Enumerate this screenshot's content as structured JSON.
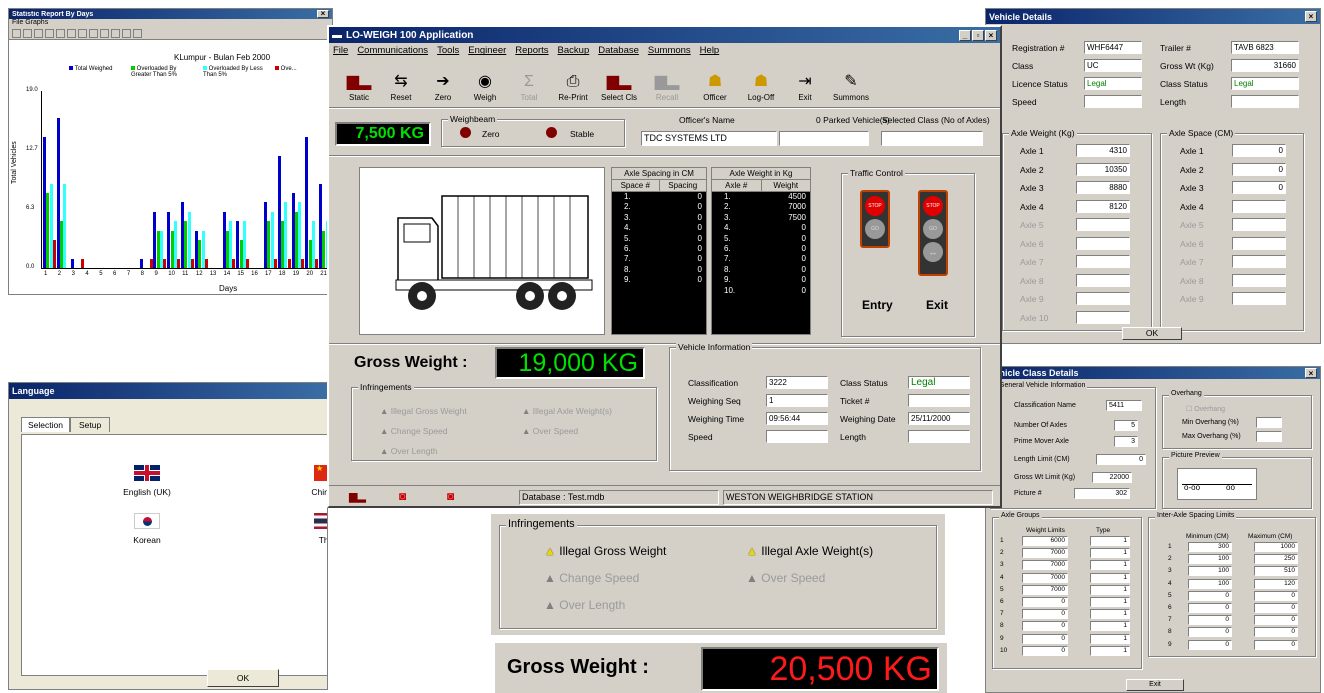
{
  "stat": {
    "title": "Statistic Report By Days",
    "menu": [
      "File",
      "Graphs"
    ],
    "chart_title": "KLumpur - Bulan Feb 2000",
    "legend": [
      "Total Weighed",
      "Overloaded By Greater Than 5%",
      "Overloaded By Less Than 5%",
      "Ove..."
    ],
    "ylabel": "Total Vehicles",
    "xlabel": "Days",
    "yticks": [
      "19.0",
      "12.7",
      "6.3",
      "0.0"
    ]
  },
  "chart_data": {
    "type": "bar",
    "categories": [
      "1",
      "2",
      "3",
      "4",
      "5",
      "6",
      "7",
      "8",
      "9",
      "10",
      "11",
      "12",
      "13",
      "14",
      "15",
      "16",
      "17",
      "18",
      "19",
      "20",
      "21"
    ],
    "series": [
      {
        "name": "Total Weighed",
        "color": "#0000cc",
        "values": [
          14,
          16,
          1,
          0,
          0,
          0,
          0,
          1,
          6,
          6,
          7,
          4,
          0,
          6,
          5,
          0,
          7,
          12,
          8,
          14,
          9
        ]
      },
      {
        "name": "Overloaded By Greater Than 5%",
        "color": "#00cc00",
        "values": [
          8,
          5,
          0,
          0,
          0,
          0,
          0,
          0,
          4,
          4,
          5,
          3,
          0,
          4,
          3,
          0,
          5,
          5,
          6,
          3,
          4
        ]
      },
      {
        "name": "Overloaded By Less Than 5%",
        "color": "#33ffff",
        "values": [
          9,
          9,
          0,
          0,
          0,
          0,
          0,
          0,
          4,
          5,
          6,
          4,
          0,
          5,
          5,
          0,
          6,
          7,
          7,
          5,
          5
        ]
      },
      {
        "name": "Ove...",
        "color": "#cc0000",
        "values": [
          3,
          0,
          1,
          0,
          0,
          0,
          0,
          1,
          1,
          1,
          1,
          1,
          0,
          1,
          1,
          0,
          1,
          1,
          1,
          1,
          1
        ]
      }
    ],
    "ylim": [
      0,
      19
    ],
    "xlabel": "Days",
    "ylabel": "Total Vehicles",
    "title": "KLumpur - Bulan Feb 2000"
  },
  "lw": {
    "title": "LO-WEIGH 100 Application",
    "menu": [
      "File",
      "Communications",
      "Tools",
      "Engineer",
      "Reports",
      "Backup",
      "Database",
      "Summons",
      "Help"
    ],
    "tools": [
      "Static",
      "Reset",
      "Zero",
      "Weigh",
      "Total",
      "Re-Print",
      "Select Cls",
      "Recall",
      "Officer",
      "Log-Off",
      "Exit",
      "Summons"
    ],
    "weight": "7,500 KG",
    "weighbeam": "Weighbeam",
    "zero": "Zero",
    "stable": "Stable",
    "officer_label": "Officer's Name",
    "parked": "0  Parked Vehicle(s)",
    "selclass": "Selected Class (No of Axles)",
    "officer": "TDC SYSTEMS LTD",
    "sp_head": "Axle Spacing in CM",
    "sp_cols": [
      "Space #",
      "Spacing"
    ],
    "sp_rows": [
      [
        "1.",
        "0"
      ],
      [
        "2.",
        "0"
      ],
      [
        "3.",
        "0"
      ],
      [
        "4.",
        "0"
      ],
      [
        "5.",
        "0"
      ],
      [
        "6.",
        "0"
      ],
      [
        "7.",
        "0"
      ],
      [
        "8.",
        "0"
      ],
      [
        "9.",
        "0"
      ]
    ],
    "wt_head": "Axle Weight in Kg",
    "wt_cols": [
      "Axle #",
      "Weight"
    ],
    "wt_rows": [
      [
        "1.",
        "4500"
      ],
      [
        "2.",
        "7000"
      ],
      [
        "3.",
        "7500"
      ],
      [
        "4.",
        "0"
      ],
      [
        "5.",
        "0"
      ],
      [
        "6.",
        "0"
      ],
      [
        "7.",
        "0"
      ],
      [
        "8.",
        "0"
      ],
      [
        "9.",
        "0"
      ],
      [
        "10.",
        "0"
      ]
    ],
    "traffic": "Traffic Control",
    "stop": "STOP",
    "go": "GO",
    "entry": "Entry",
    "exit": "Exit",
    "gross_label": "Gross Weight :",
    "gross": "19,000 KG",
    "infr": "Infringements",
    "infr_items": [
      "Illegal Gross Weight",
      "Illegal Axle Weight(s)",
      "Change Speed",
      "Over Speed",
      "Over Length"
    ],
    "vinfo": "Vehicle Information",
    "classification": "Classification",
    "classification_v": "3222",
    "seq": "Weighing Seq",
    "seq_v": "1",
    "time": "Weighing Time",
    "time_v": "09:56:44",
    "speed": "Speed",
    "cstatus": "Class Status",
    "cstatus_v": "Legal",
    "ticket": "Ticket #",
    "wdate": "Weighing Date",
    "wdate_v": "25/11/2000",
    "length": "Length",
    "db": "Database : Test.mdb",
    "station": "WESTON WEIGHBRIDGE STATION"
  },
  "vd": {
    "title": "Vehicle Details",
    "reg": "Registration #",
    "reg_v": "WHF6447",
    "trailer": "Trailer #",
    "trailer_v": "TAVB 6823",
    "class": "Class",
    "class_v": "UC",
    "gross": "Gross Wt (Kg)",
    "gross_v": "31660",
    "lic": "Licence Status",
    "lic_v": "Legal",
    "cstat": "Class Status",
    "cstat_v": "Legal",
    "speed": "Speed",
    "length": "Length",
    "aw": "Axle Weight (Kg)",
    "as": "Axle Space (CM)",
    "axles": [
      "Axle 1",
      "Axle 2",
      "Axle 3",
      "Axle 4",
      "Axle 5",
      "Axle 6",
      "Axle 7",
      "Axle 8",
      "Axle 9",
      "Axle 10"
    ],
    "aw_v": [
      "4310",
      "10350",
      "8880",
      "8120",
      "",
      "",
      "",
      "",
      "",
      ""
    ],
    "as_v": [
      "0",
      "0",
      "0",
      "",
      "",
      "",
      "",
      "",
      ""
    ],
    "ok": "OK"
  },
  "lang": {
    "title": "Language",
    "tabs": [
      "Selection",
      "Setup"
    ],
    "items": [
      "English (UK)",
      "Chinese",
      "Korean",
      "Thai"
    ],
    "ok": "OK"
  },
  "vc": {
    "title": "Vehicle Class Details",
    "gen": "General Vehicle Information",
    "cname": "Classification Name",
    "cname_v": "5411",
    "nax": "Number Of Axles",
    "nax_v": "5",
    "pma": "Prime Mover Axle",
    "pma_v": "3",
    "llim": "Length Limit (CM)",
    "llim_v": "0",
    "gwl": "Gross Wt Limit (Kg)",
    "gwl_v": "22000",
    "pic": "Picture #",
    "pic_v": "302",
    "ovh": "Overhang",
    "ovh_cb": "Overhang",
    "minov": "Min Overhang (%)",
    "maxov": "Max Overhang (%)",
    "prev": "Picture Preview",
    "ag": "Axle Groups",
    "wl": "Weight Limits",
    "type": "Type",
    "ag_rows": [
      [
        "1",
        "6000",
        "1"
      ],
      [
        "2",
        "7000",
        "1"
      ],
      [
        "3",
        "7000",
        "1"
      ],
      [
        "4",
        "7000",
        "1"
      ],
      [
        "5",
        "7000",
        "1"
      ],
      [
        "6",
        "0",
        "1"
      ],
      [
        "7",
        "0",
        "1"
      ],
      [
        "8",
        "0",
        "1"
      ],
      [
        "9",
        "0",
        "1"
      ],
      [
        "10",
        "0",
        "1"
      ]
    ],
    "ias": "Inter-Axle Spacing Limits",
    "min": "Minimum (CM)",
    "max": "Maximum (CM)",
    "ias_rows": [
      [
        "1",
        "300",
        "1000"
      ],
      [
        "2",
        "100",
        "250"
      ],
      [
        "3",
        "100",
        "510"
      ],
      [
        "4",
        "100",
        "120"
      ],
      [
        "5",
        "0",
        "0"
      ],
      [
        "6",
        "0",
        "0"
      ],
      [
        "7",
        "0",
        "0"
      ],
      [
        "8",
        "0",
        "0"
      ],
      [
        "9",
        "0",
        "0"
      ]
    ],
    "exit": "Exit"
  },
  "infz": {
    "title": "Infringements",
    "items": [
      "Illegal Gross Weight",
      "Illegal Axle Weight(s)",
      "Change Speed",
      "Over Speed",
      "Over Length"
    ]
  },
  "gz": {
    "label": "Gross Weight :",
    "value": "20,500 KG"
  }
}
